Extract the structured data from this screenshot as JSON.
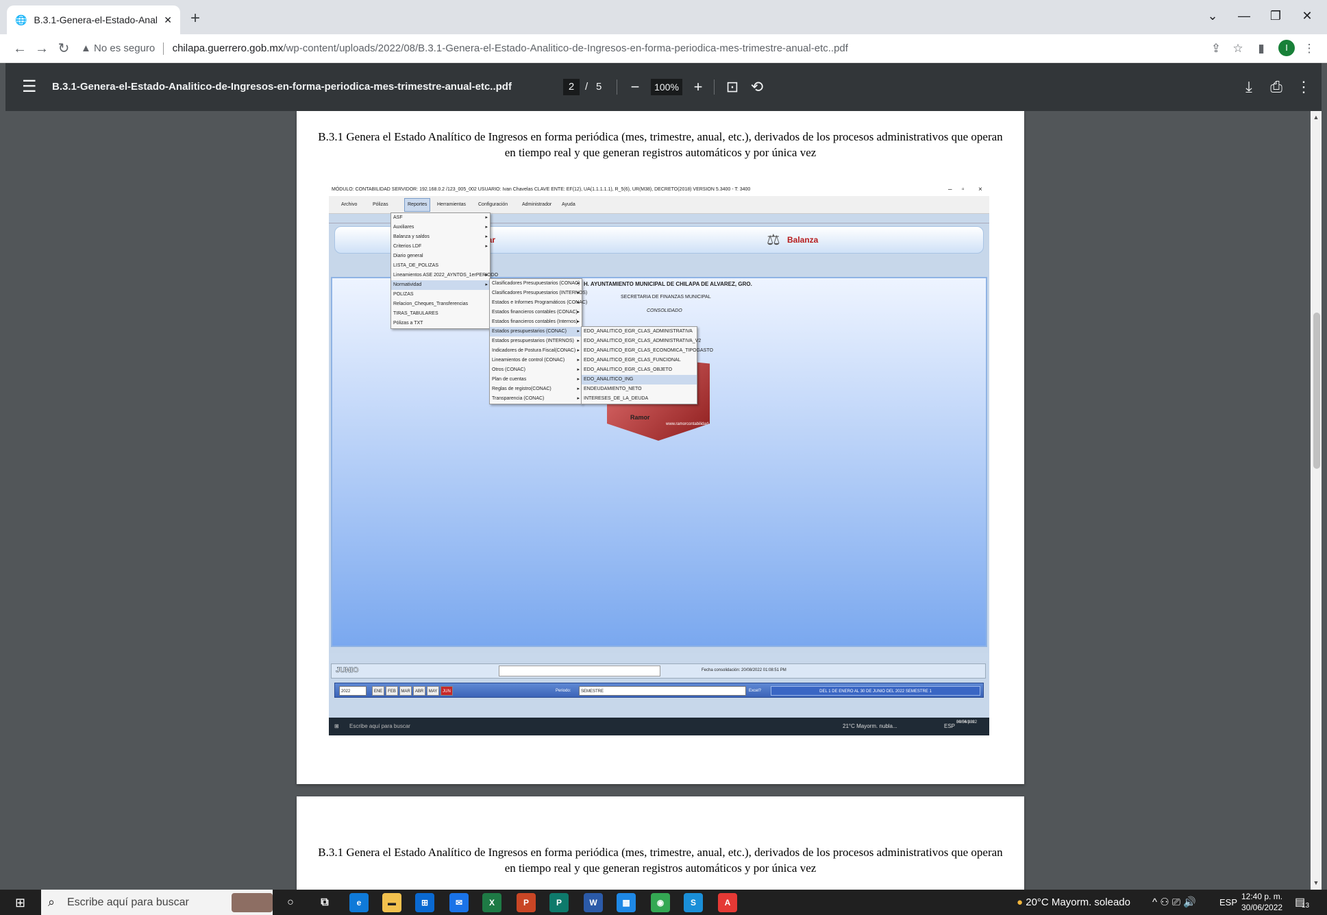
{
  "browser": {
    "tab_title": "B.3.1-Genera-el-Estado-Analitico",
    "security": "No es seguro",
    "url_host": "chilapa.guerrero.gob.mx",
    "url_path": "/wp-content/uploads/2022/08/B.3.1-Genera-el-Estado-Analitico-de-Ingresos-en-forma-periodica-mes-trimestre-anual-etc..pdf",
    "profile_initial": "I",
    "accent": "#188038"
  },
  "pdf_toolbar": {
    "filename": "B.3.1-Genera-el-Estado-Analitico-de-Ingresos-en-forma-periodica-mes-trimestre-anual-etc..pdf",
    "current_page": "2",
    "page_sep": "/",
    "total_pages": "5",
    "zoom": "100%"
  },
  "pages": {
    "caption_line1": "B.3.1 Genera el Estado Analítico de Ingresos en forma periódica (mes, trimestre, anual, etc.), derivados de los procesos administrativos que operan",
    "caption_line2": "en tiempo real y que generan registros automáticos y por única vez"
  },
  "screenshot": {
    "titlebar": "MÓDULO: CONTABILIDAD    SERVIDOR: 192.168.0.2 /123_005_002    USUARIO: Ivan Chavelas    CLAVE ENTE: EF(12), UA(1.1.1.1.1), R_5(6), UR(M38), DECRETO(2018) VERSION 5.3400 - T: 3400",
    "menu": [
      "Archivo",
      "Pólizas",
      "Reportes",
      "Herramientas",
      "Configuración",
      "Administrador",
      "Ayuda"
    ],
    "panel_left": "trar",
    "panel_right": "Balanza",
    "entity": "H. AYUNTAMIENTO MUNICIPAL DE CHILAPA DE ALVAREZ, GRO.",
    "secretaria": "SECRETARIA DE FINANZAS MUNICIPAL",
    "consolidado": "CONSOLIDADO",
    "logo_text1": "ion",
    "logo_text2": "Ramor",
    "logo_url": "www.ramorcontabilidad.com.mx",
    "menu_reportes": [
      "ASF",
      "Auxiliares",
      "Balanza y saldos",
      "Criterios LDF",
      "Diario general",
      "LISTA_DE_POLIZAS",
      "Lineamientos ASE 2022_AYNTOS_1erPERIODO",
      "Normatividad",
      "POLIZAS",
      "Relacion_Cheques_Transferencias",
      "TIRAS_TABULARES",
      "Pólizas a TXT"
    ],
    "menu_normatividad": [
      "Clasificadores Presupuestarios (CONAC)",
      "Clasificadores Presupuestarios (INTERNOS)",
      "Estados e Informes Programáticos (CONAC)",
      "Estados financieros contables (CONAC)",
      "Estados financieros contables (Internos)",
      "Estados presupuestarios (CONAC)",
      "Estados presupuestarios (INTERNOS)",
      "Indicadores de Postura Fiscal(CONAC)",
      "Lineamientos de control (CONAC)",
      "Otros (CONAC)",
      "Plan de cuentas",
      "Reglas de registro(CONAC)",
      "Transparencia (CONAC)"
    ],
    "menu_estados": [
      "EDO_ANALITICO_EGR_CLAS_ADMINISTRATIVA",
      "EDO_ANALITICO_EGR_CLAS_ADMINISTRATIVA_V2",
      "EDO_ANALITICO_EGR_CLAS_ECONOMICA_TIPOGASTO",
      "EDO_ANALITICO_EGR_CLAS_FUNCIONAL",
      "EDO_ANALITICO_EGR_CLAS_OBJETO",
      "EDO_ANALITICO_ING",
      "ENDEUDAMIENTO_NETO",
      "INTERESES_DE_LA_DEUDA"
    ],
    "month_label": "JUNIO",
    "fecha_consolidacion": "Fecha consolidación: 20/08/2022 01:08:51 PM",
    "year": "2022",
    "months": [
      "ENE",
      "FEB",
      "MAR",
      "ABR",
      "MAY",
      "JUN"
    ],
    "periodo_label": "Periodo:",
    "periodo_value": "SEMESTRE",
    "excel_label": "Excel?",
    "range": "DEL 1 DE ENERO AL 30 DE JUNIO DEL 2022 SEMESTRE 1",
    "taskbar_search": "Escribe aquí para buscar",
    "taskbar_weather": "21°C  Mayorm. nubla...",
    "taskbar_lang": "ESP",
    "taskbar_time": "04:54 p.m.",
    "taskbar_date": "30/06/2022"
  },
  "taskbar": {
    "search_placeholder": "Escribe aquí para buscar",
    "weather": "20°C  Mayorm. soleado",
    "lang": "ESP",
    "time": "12:40 p. m.",
    "date": "30/06/2022",
    "notifications": "13"
  }
}
